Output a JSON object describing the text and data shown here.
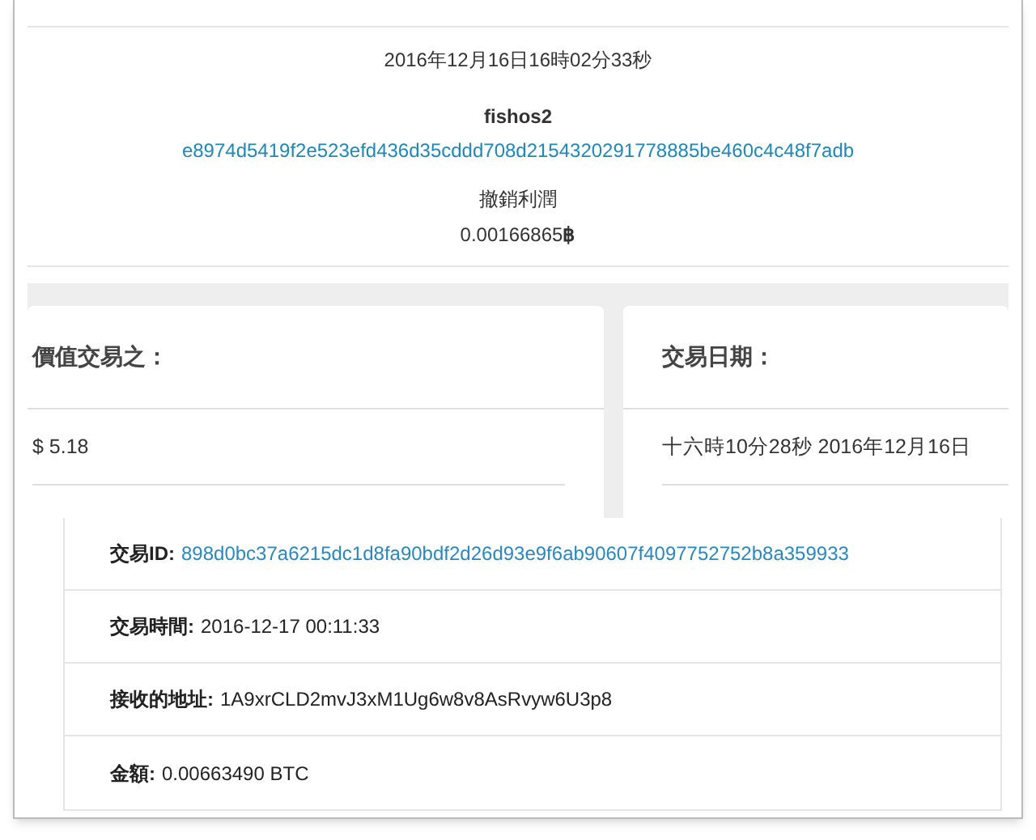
{
  "header": {
    "date": "2016年12月16日16時02分33秒",
    "user": "fishos2",
    "hash": "e8974d5419f2e523efd436d35cddd708d2154320291778885be460c4c48f7adb",
    "label": "撤銷利潤",
    "amount": "0.00166865",
    "currency_symbol": "฿"
  },
  "cards": [
    {
      "title": "價值交易之：",
      "value": "$ 5.18"
    },
    {
      "title": "交易日期：",
      "value": "十六時10分28秒 2016年12月16日"
    }
  ],
  "details": [
    {
      "label": "交易ID:",
      "value": "898d0bc37a6215dc1d8fa90bdf2d26d93e9f6ab90607f4097752752b8a359933",
      "kind": "link"
    },
    {
      "label": "交易時間:",
      "value": "2016-12-17 00:11:33",
      "kind": "text"
    },
    {
      "label": "接收的地址:",
      "value": "1A9xrCLD2mvJ3xM1Ug6w8v8AsRvyw6U3p8",
      "kind": "text"
    },
    {
      "label": "金額:",
      "value": "0.00663490 BTC",
      "kind": "text"
    }
  ]
}
